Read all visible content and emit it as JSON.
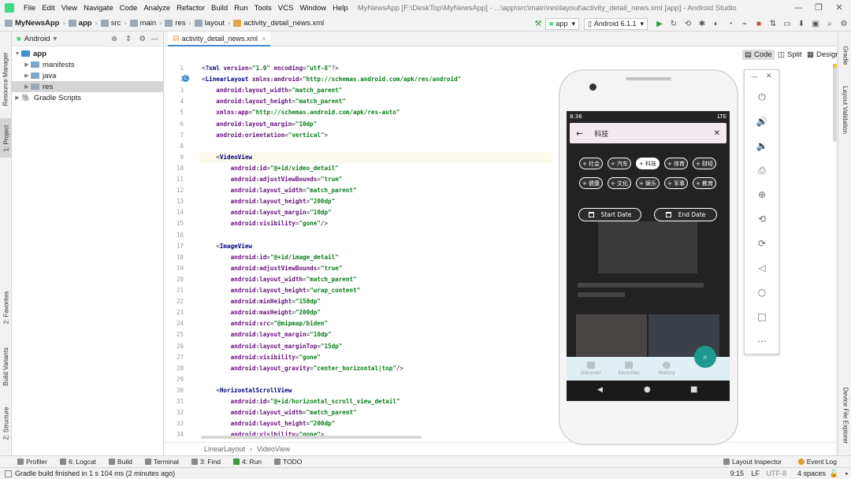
{
  "window": {
    "title": "MyNewsApp [F:\\DeskTop\\MyNewsApp] - ...\\app\\src\\main\\res\\layout\\activity_detail_news.xml [app] - Android Studio",
    "menu": [
      "File",
      "Edit",
      "View",
      "Navigate",
      "Code",
      "Analyze",
      "Refactor",
      "Build",
      "Run",
      "Tools",
      "VCS",
      "Window",
      "Help"
    ]
  },
  "navbar": {
    "breadcrumbs": [
      "MyNewsApp",
      "app",
      "src",
      "main",
      "res",
      "layout",
      "activity_detail_news.xml"
    ],
    "run_config": "app",
    "device": "Android 6.1.1"
  },
  "left_tabs": [
    "Resource Manager",
    "1: Project",
    "2: Favorites",
    "Build Variants",
    "Z: Structure"
  ],
  "right_tabs": [
    "Gradle",
    "Layout Validation",
    "Device File Explorer"
  ],
  "project": {
    "view_mode": "Android",
    "tree": [
      {
        "label": "app",
        "depth": 0,
        "expanded": true,
        "bold": true
      },
      {
        "label": "manifests",
        "depth": 1,
        "expanded": false
      },
      {
        "label": "java",
        "depth": 1,
        "expanded": false
      },
      {
        "label": "res",
        "depth": 1,
        "expanded": false,
        "selected": true
      },
      {
        "label": "Gradle Scripts",
        "depth": 0,
        "expanded": false
      }
    ]
  },
  "editor": {
    "tab": "activity_detail_news.xml",
    "modes": [
      "Code",
      "Split",
      "Design"
    ],
    "active_mode": "Code",
    "highlight_line": 9,
    "lines": [
      {
        "n": "1",
        "text": "<?xml version=\"1.0\" encoding=\"utf-8\"?>"
      },
      {
        "n": "2",
        "text": "<LinearLayout xmlns:android=\"http://schemas.android.com/apk/res/android\""
      },
      {
        "n": "3",
        "text": "    android:layout_width=\"match_parent\""
      },
      {
        "n": "4",
        "text": "    android:layout_height=\"match_parent\""
      },
      {
        "n": "5",
        "text": "    xmlns:app=\"http://schemas.android.com/apk/res-auto\""
      },
      {
        "n": "6",
        "text": "    android:layout_margin=\"10dp\""
      },
      {
        "n": "7",
        "text": "    android:orientation=\"vertical\">"
      },
      {
        "n": "8",
        "text": ""
      },
      {
        "n": "9",
        "text": "    <VideoView"
      },
      {
        "n": "10",
        "text": "        android:id=\"@+id/video_detail\""
      },
      {
        "n": "11",
        "text": "        android:adjustViewBounds=\"true\""
      },
      {
        "n": "12",
        "text": "        android:layout_width=\"match_parent\""
      },
      {
        "n": "13",
        "text": "        android:layout_height=\"200dp\""
      },
      {
        "n": "14",
        "text": "        android:layout_margin=\"10dp\""
      },
      {
        "n": "15",
        "text": "        android:visibility=\"gone\"/>"
      },
      {
        "n": "16",
        "text": ""
      },
      {
        "n": "17",
        "text": "    <ImageView"
      },
      {
        "n": "18",
        "text": "        android:id=\"@+id/image_detail\""
      },
      {
        "n": "19",
        "text": "        android:adjustViewBounds=\"true\""
      },
      {
        "n": "20",
        "text": "        android:layout_width=\"match_parent\""
      },
      {
        "n": "21",
        "text": "        android:layout_height=\"wrap_content\""
      },
      {
        "n": "22",
        "text": "        android:minHeight=\"150dp\""
      },
      {
        "n": "23",
        "text": "        android:maxHeight=\"200dp\""
      },
      {
        "n": "24",
        "text": "        android:src=\"@mipmap/biden\""
      },
      {
        "n": "25",
        "text": "        android:layout_margin=\"10dp\""
      },
      {
        "n": "26",
        "text": "        android:layout_marginTop=\"15dp\""
      },
      {
        "n": "27",
        "text": "        android:visibility=\"gone\""
      },
      {
        "n": "28",
        "text": "        android:layout_gravity=\"center_horizontal|top\"/>"
      },
      {
        "n": "29",
        "text": ""
      },
      {
        "n": "30",
        "text": "    <HorizontalScrollView"
      },
      {
        "n": "31",
        "text": "        android:id=\"@+id/horizontal_scroll_view_detail\""
      },
      {
        "n": "32",
        "text": "        android:layout_width=\"match_parent\""
      },
      {
        "n": "33",
        "text": "        android:layout_height=\"200dp\""
      },
      {
        "n": "34",
        "text": "        android:visibility=\"gone\">"
      }
    ],
    "breadcrumb": [
      "LinearLayout",
      "VideoView"
    ]
  },
  "emulator": {
    "status_time": "8:36",
    "status_right": "LTE",
    "search_text": "科技",
    "chips_row1": [
      "+ 社会",
      "+ 汽车",
      "+ 科技",
      "+ 体育",
      "+ 财经"
    ],
    "chips_row2": [
      "+ 健康",
      "+ 文化",
      "+ 娱乐",
      "+ 军事",
      "+ 教育"
    ],
    "selected_chip": "+ 科技",
    "start_date": "Start Date",
    "end_date": "End Date",
    "bottom_nav": [
      "Discover",
      "Favorites",
      "History"
    ]
  },
  "bottom_tools": [
    "Profiler",
    "6: Logcat",
    "Build",
    "Terminal",
    "3: Find",
    "4: Run",
    "TODO"
  ],
  "bottom_tools_right": [
    "Layout Inspector",
    "Event Log"
  ],
  "status": {
    "message": "Gradle build finished in 1 s 104 ms (2 minutes ago)",
    "position": "9:15",
    "line_sep": "LF",
    "encoding": "UTF-8",
    "indent": "4 spaces"
  }
}
